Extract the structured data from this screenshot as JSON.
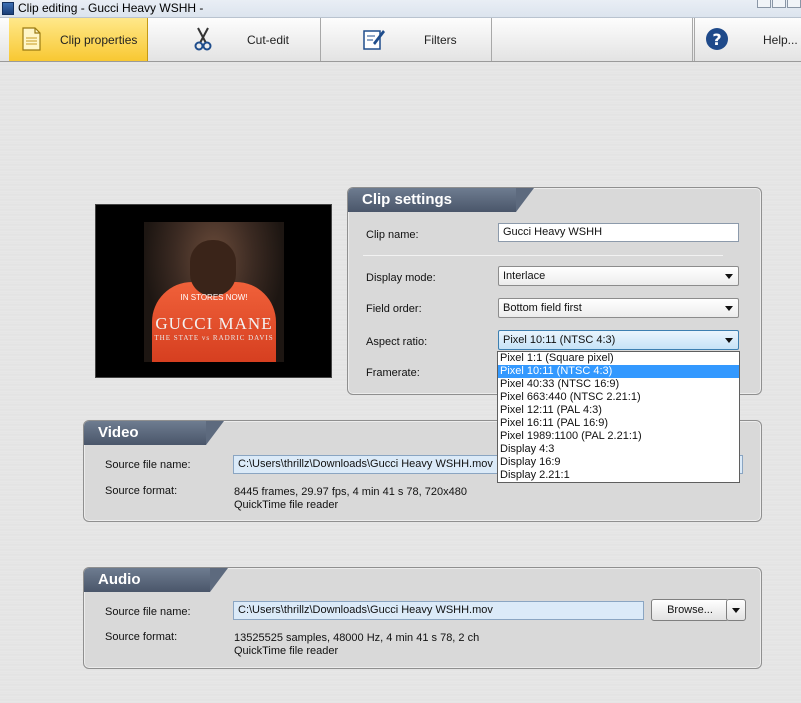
{
  "window": {
    "title": "Clip editing - Gucci Heavy WSHH -"
  },
  "toolbar": {
    "tabs": [
      {
        "label": "Clip properties",
        "icon": "document-icon",
        "active": true
      },
      {
        "label": "Cut-edit",
        "icon": "scissors-icon",
        "active": false
      },
      {
        "label": "Filters",
        "icon": "edit-filter-icon",
        "active": false
      }
    ],
    "help": {
      "label": "Help...",
      "icon": "help-icon"
    }
  },
  "preview": {
    "album_text": {
      "banner": "IN STORES NOW!",
      "artist": "GUCCI MANE",
      "subtitle": "THE STATE vs RADRIC DAVIS"
    }
  },
  "clip_settings": {
    "heading": "Clip settings",
    "clip_name_label": "Clip name:",
    "clip_name_value": "Gucci Heavy WSHH",
    "display_mode_label": "Display mode:",
    "display_mode_value": "Interlace",
    "field_order_label": "Field order:",
    "field_order_value": "Bottom field first",
    "aspect_ratio_label": "Aspect ratio:",
    "aspect_ratio_value": "Pixel 10:11 (NTSC 4:3)",
    "framerate_label": "Framerate:",
    "aspect_ratio_options": [
      "Pixel 1:1 (Square pixel)",
      "Pixel 10:11 (NTSC 4:3)",
      "Pixel 40:33 (NTSC 16:9)",
      "Pixel 663:440 (NTSC 2.21:1)",
      "Pixel 12:11 (PAL 4:3)",
      "Pixel 16:11 (PAL 16:9)",
      "Pixel 1989:1100 (PAL 2.21:1)",
      "Display 4:3",
      "Display 16:9",
      "Display 2.21:1"
    ],
    "aspect_ratio_selected_index": 1
  },
  "video": {
    "heading": "Video",
    "source_file_label": "Source file name:",
    "source_file_value": "C:\\Users\\thrillz\\Downloads\\Gucci Heavy WSHH.mov",
    "source_format_label": "Source format:",
    "format_line1": "8445  frames,  29.97  fps,  4 min 41 s 78,  720x480",
    "format_line2": "QuickTime file reader"
  },
  "audio": {
    "heading": "Audio",
    "source_file_label": "Source file name:",
    "source_file_value": "C:\\Users\\thrillz\\Downloads\\Gucci Heavy WSHH.mov",
    "browse_label": "Browse...",
    "source_format_label": "Source format:",
    "format_line1": "13525525  samples,  48000  Hz,  4 min 41 s 78,  2 ch",
    "format_line2": "QuickTime file reader"
  }
}
